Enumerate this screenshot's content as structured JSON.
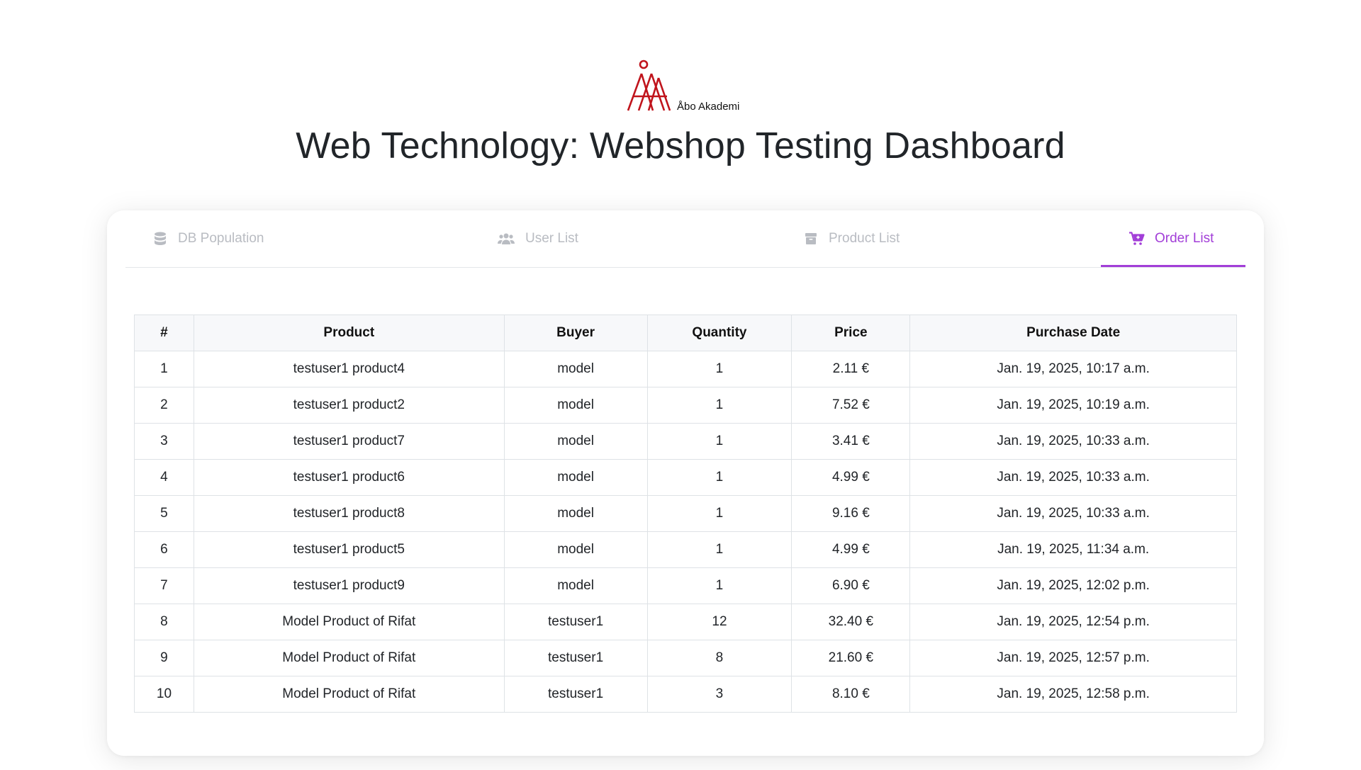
{
  "brand": {
    "logo_text": "Åbo Akademi",
    "logo_color": "#c0141c"
  },
  "page_title": "Web Technology: Webshop Testing Dashboard",
  "tabs": [
    {
      "label": "DB Population",
      "icon": "database-icon",
      "active": false
    },
    {
      "label": "User List",
      "icon": "users-icon",
      "active": false
    },
    {
      "label": "Product List",
      "icon": "box-icon",
      "active": false
    },
    {
      "label": "Order List",
      "icon": "cart-icon",
      "active": true
    }
  ],
  "colors": {
    "accent": "#a23ed8",
    "inactive_tab": "#b9bcc2",
    "header_bg": "#f7f8fa"
  },
  "orders": {
    "columns": [
      "#",
      "Product",
      "Buyer",
      "Quantity",
      "Price",
      "Purchase Date"
    ],
    "rows": [
      [
        "1",
        "testuser1 product4",
        "model",
        "1",
        "2.11 €",
        "Jan. 19, 2025, 10:17 a.m."
      ],
      [
        "2",
        "testuser1 product2",
        "model",
        "1",
        "7.52 €",
        "Jan. 19, 2025, 10:19 a.m."
      ],
      [
        "3",
        "testuser1 product7",
        "model",
        "1",
        "3.41 €",
        "Jan. 19, 2025, 10:33 a.m."
      ],
      [
        "4",
        "testuser1 product6",
        "model",
        "1",
        "4.99 €",
        "Jan. 19, 2025, 10:33 a.m."
      ],
      [
        "5",
        "testuser1 product8",
        "model",
        "1",
        "9.16 €",
        "Jan. 19, 2025, 10:33 a.m."
      ],
      [
        "6",
        "testuser1 product5",
        "model",
        "1",
        "4.99 €",
        "Jan. 19, 2025, 11:34 a.m."
      ],
      [
        "7",
        "testuser1 product9",
        "model",
        "1",
        "6.90 €",
        "Jan. 19, 2025, 12:02 p.m."
      ],
      [
        "8",
        "Model Product of Rifat",
        "testuser1",
        "12",
        "32.40 €",
        "Jan. 19, 2025, 12:54 p.m."
      ],
      [
        "9",
        "Model Product of Rifat",
        "testuser1",
        "8",
        "21.60 €",
        "Jan. 19, 2025, 12:57 p.m."
      ],
      [
        "10",
        "Model Product of Rifat",
        "testuser1",
        "3",
        "8.10 €",
        "Jan. 19, 2025, 12:58 p.m."
      ]
    ]
  }
}
